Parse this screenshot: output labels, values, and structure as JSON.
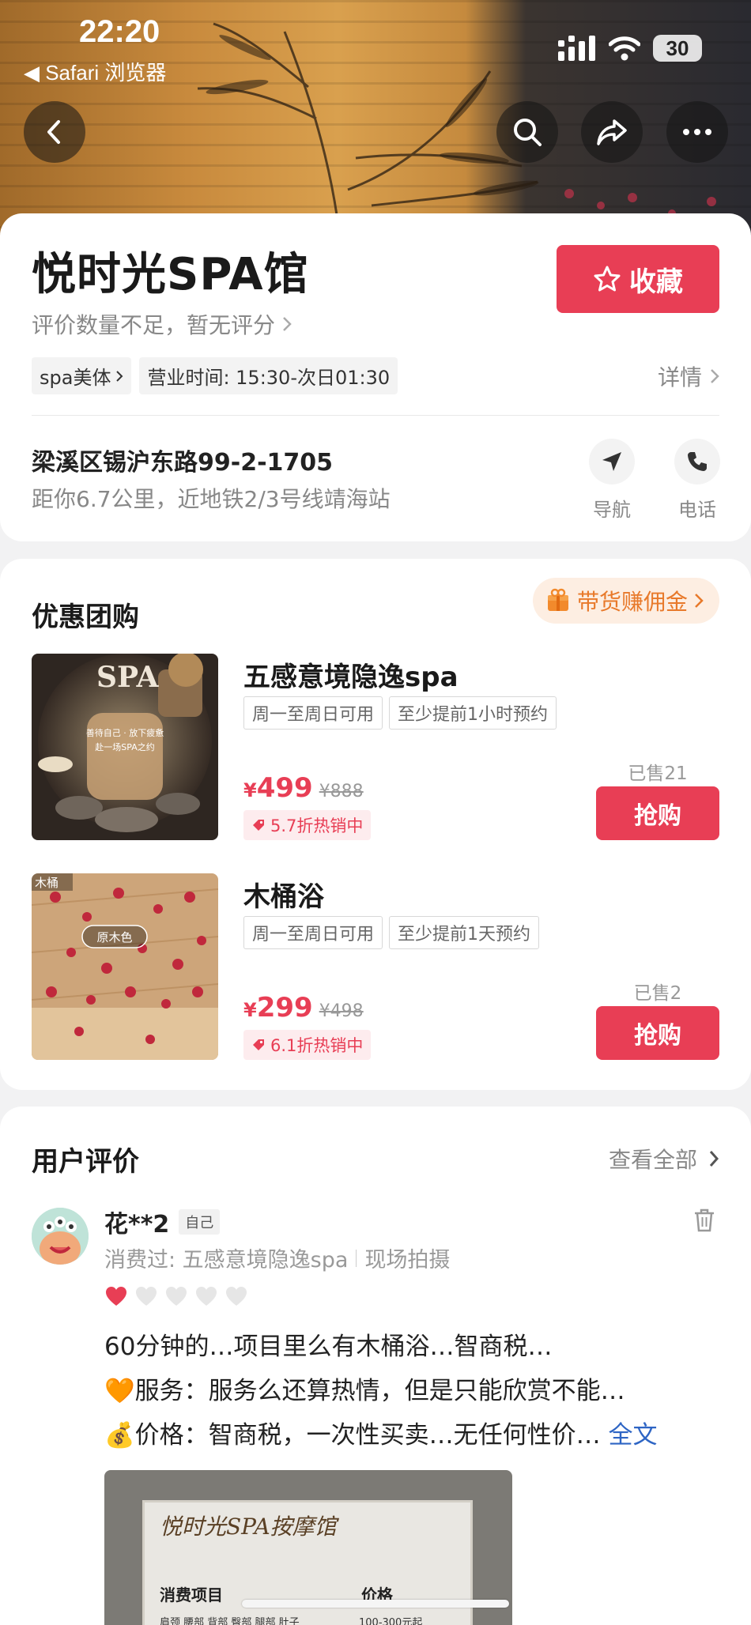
{
  "status_bar": {
    "time": "22:20",
    "back_app": "◀ Safari 浏览器",
    "battery": "30"
  },
  "shop": {
    "name": "悦时光SPA馆",
    "rating_text": "评价数量不足，暂无评分",
    "favorite_label": "收藏",
    "category_tag": "spa美体",
    "hours_tag": "营业时间: 15:30-次日01:30",
    "detail_label": "详情",
    "address": "梁溪区锡沪东路99-2-1705",
    "distance": "距你6.7公里，近地铁2/3号线靖海站",
    "nav_label": "导航",
    "phone_label": "电话"
  },
  "deals": {
    "title": "优惠团购",
    "commission_label": "带货赚佣金",
    "items": [
      {
        "name": "五感意境隐逸spa",
        "tags": [
          "周一至周日可用",
          "至少提前1小时预约"
        ],
        "currency": "¥",
        "price": "499",
        "original_price": "¥888",
        "discount": "5.7折热销中",
        "sold": "已售21",
        "buy_label": "抢购",
        "image_heading": "SPA",
        "image_caption_1": "善待自己 · 放下疲惫",
        "image_caption_2": "赴一场SPA之约"
      },
      {
        "name": "木桶浴",
        "tags": [
          "周一至周日可用",
          "至少提前1天预约"
        ],
        "currency": "¥",
        "price": "299",
        "original_price": "¥498",
        "discount": "6.1折热销中",
        "sold": "已售2",
        "buy_label": "抢购",
        "image_corner": "木桶",
        "image_label": "原木色"
      }
    ]
  },
  "reviews": {
    "title": "用户评价",
    "view_all": "查看全部",
    "items": [
      {
        "user": "花**2",
        "badge": "自己",
        "consumed": "消费过: 五感意境隐逸spa",
        "source": "现场拍摄",
        "rating": 1,
        "rating_max": 5,
        "line1": "60分钟的…项目里么有木桶浴…智商税…",
        "line2_emoji": "🧡",
        "line2": "服务：服务么还算热情，但是只能欣赏不能…",
        "line3_emoji": "💰",
        "line3": "价格：智商税，一次性买卖…无任何性价…",
        "more": "全文",
        "photo_title": "悦时光SPA按摩馆",
        "photo_col1": "消费项目",
        "photo_col2": "价格",
        "photo_row": "肩颈 腰部 背部 臀部 腿部 肚子",
        "photo_row_price": "100-300元起"
      }
    ]
  },
  "colors": {
    "accent": "#e83e55",
    "commission": "#e8792a",
    "link": "#2e65c4"
  }
}
